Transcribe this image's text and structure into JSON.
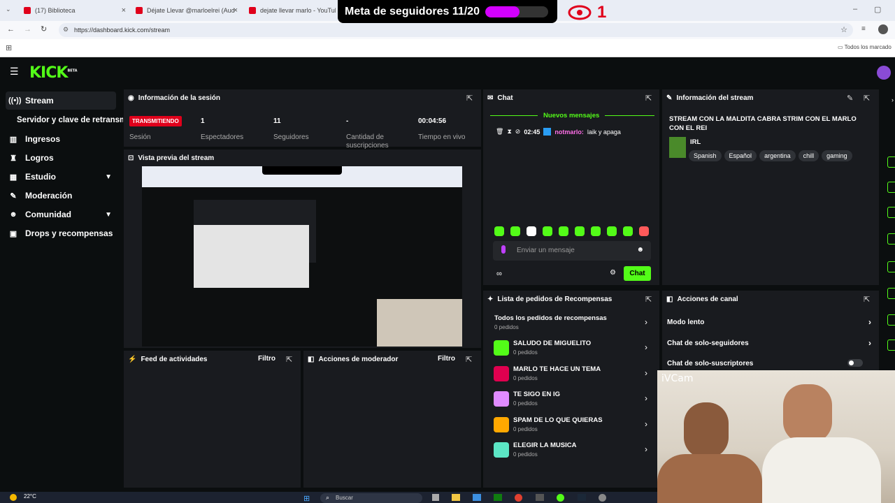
{
  "browser": {
    "tabs": [
      {
        "label": "(17) Biblioteca"
      },
      {
        "label": "Déjate Llevar @marloelrei (Aud"
      },
      {
        "label": "dejate llevar marlo - YouTube"
      }
    ],
    "url": "https://dashboard.kick.com/stream",
    "bookmarks_label": "Todos los marcado"
  },
  "overlay": {
    "goal_label": "Meta de seguidores 11/20",
    "goal_progress": 0.55,
    "viewer_count": "1",
    "accent": "#d400ff",
    "eye_color": "#e0001b"
  },
  "kick": {
    "logo": "KICK",
    "logo_sup": "BETA",
    "brand_color": "#53fc18"
  },
  "sidebar": {
    "items": [
      {
        "label": "Stream",
        "icon": "broadcast-icon"
      },
      {
        "label": "Servidor y clave de retransm",
        "icon": ""
      },
      {
        "label": "Ingresos",
        "icon": "chart-icon"
      },
      {
        "label": "Logros",
        "icon": "trophy-icon"
      },
      {
        "label": "Estudio",
        "icon": "grid-icon"
      },
      {
        "label": "Moderación",
        "icon": "wrench-icon"
      },
      {
        "label": "Comunidad",
        "icon": "users-icon"
      },
      {
        "label": "Drops y recompensas",
        "icon": "gift-icon"
      }
    ]
  },
  "session": {
    "title": "Información de la sesión",
    "status": "TRANSMITIENDO",
    "status_label": "Sesión",
    "stats": [
      {
        "value": "1",
        "label": "Espectadores"
      },
      {
        "value": "11",
        "label": "Seguidores"
      },
      {
        "value": "-",
        "label": "Cantidad de suscripciones"
      },
      {
        "value": "00:04:56",
        "label": "Tiempo en vivo"
      }
    ]
  },
  "preview": {
    "title": "Vista previa del stream"
  },
  "feed": {
    "title": "Feed de actividades",
    "filter": "Filtro"
  },
  "modactions": {
    "title": "Acciones de moderador",
    "filter": "Filtro"
  },
  "chat": {
    "title": "Chat",
    "new_messages": "Nuevos mensajes",
    "message": {
      "time": "02:45",
      "user": "notmarlo:",
      "text": "laik y apaga"
    },
    "placeholder": "Enviar un mensaje",
    "send_label": "Chat"
  },
  "streaminfo": {
    "title": "Información del stream",
    "stream_title": "STREAM CON LA MALDITA CABRA STRIM CON EL MARLO CON EL REI",
    "category": "IRL",
    "tags": [
      "Spanish",
      "Español",
      "argentina",
      "chill",
      "gaming"
    ]
  },
  "rewards": {
    "title": "Lista de pedidos de Recompensas",
    "all_label": "Todos los pedidos de recompensas",
    "all_count": "0 pedidos",
    "items": [
      {
        "name": "SALUDO DE MIGUELITO",
        "count": "0 pedidos",
        "color": "#53fc18"
      },
      {
        "name": "MARLO TE HACE UN TEMA",
        "count": "0 pedidos",
        "color": "#e0004f"
      },
      {
        "name": "TE SIGO EN IG",
        "count": "0 pedidos",
        "color": "#e08bff"
      },
      {
        "name": "SPAM DE LO QUE QUIERAS",
        "count": "0 pedidos",
        "color": "#ffa800"
      },
      {
        "name": "ELEGIR LA MUSICA",
        "count": "0 pedidos",
        "color": "#5ce6c5"
      }
    ]
  },
  "channel_actions": {
    "title": "Acciones de canal",
    "items": [
      {
        "label": "Modo lento"
      },
      {
        "label": "Chat de solo-seguidores"
      },
      {
        "label": "Chat de solo-suscriptores"
      }
    ]
  },
  "webcam": {
    "label": "iVCam"
  },
  "taskbar": {
    "weather": "22°C",
    "search": "Buscar"
  }
}
